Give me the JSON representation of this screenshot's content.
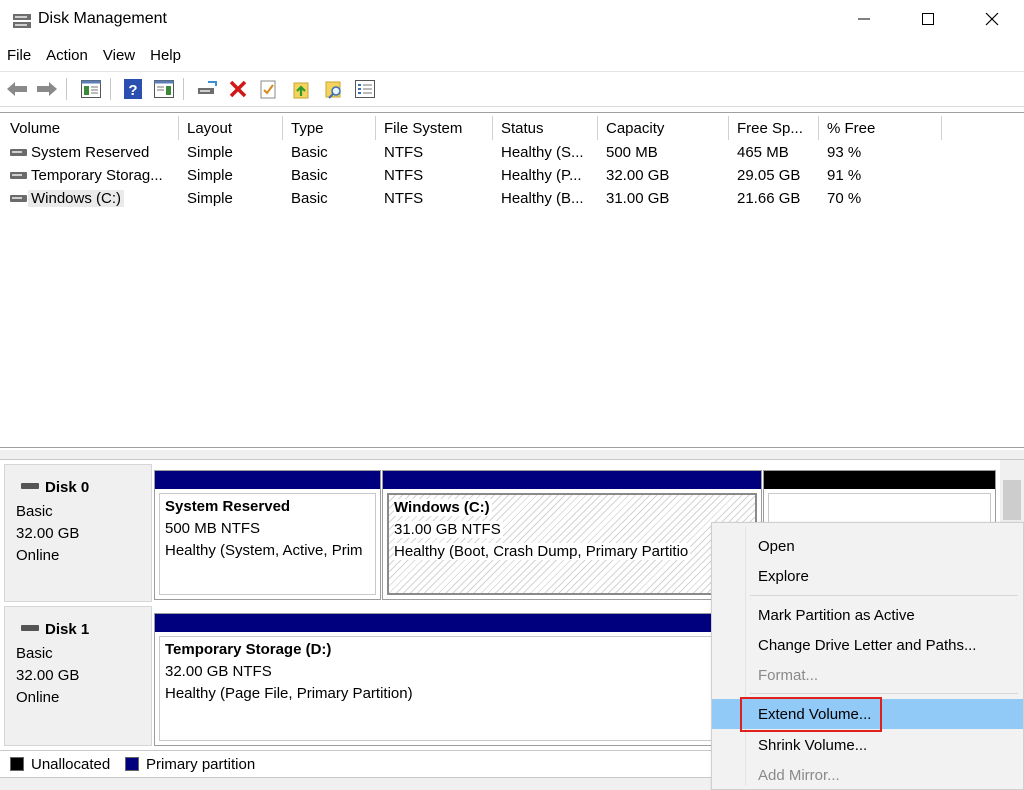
{
  "window": {
    "title": "Disk Management",
    "icon": "disk-management-icon",
    "controls": [
      "minimize-icon",
      "maximize-icon",
      "close-icon"
    ]
  },
  "menu": [
    "File",
    "Action",
    "View",
    "Help"
  ],
  "toolbar": [
    "back-arrow-icon",
    "forward-arrow-icon",
    "console-tree-icon",
    "help-icon",
    "properties-pane-icon",
    "connect-drive-icon",
    "delete-icon",
    "check-icon",
    "folder-up-icon",
    "folder-search-icon",
    "list-view-icon"
  ],
  "volume_table": {
    "columns": [
      "Volume",
      "Layout",
      "Type",
      "File System",
      "Status",
      "Capacity",
      "Free Sp...",
      "% Free"
    ],
    "rows": [
      {
        "volume": "System Reserved",
        "layout": "Simple",
        "type": "Basic",
        "fs": "NTFS",
        "status": "Healthy (S...",
        "capacity": "500 MB",
        "free": "465 MB",
        "pct": "93 %"
      },
      {
        "volume": "Temporary Storag...",
        "layout": "Simple",
        "type": "Basic",
        "fs": "NTFS",
        "status": "Healthy (P...",
        "capacity": "32.00 GB",
        "free": "29.05 GB",
        "pct": "91 %"
      },
      {
        "volume": "Windows (C:)",
        "layout": "Simple",
        "type": "Basic",
        "fs": "NTFS",
        "status": "Healthy (B...",
        "capacity": "31.00 GB",
        "free": "21.66 GB",
        "pct": "70 %"
      }
    ]
  },
  "disks": [
    {
      "name": "Disk 0",
      "type": "Basic",
      "size": "32.00 GB",
      "state": "Online",
      "partitions": [
        {
          "name": "System Reserved",
          "line1": "500 MB NTFS",
          "line2": "Healthy (System, Active, Prim"
        },
        {
          "name": "Windows  (C:)",
          "line1": "31.00 GB NTFS",
          "line2": "Healthy (Boot, Crash Dump, Primary Partitio"
        }
      ]
    },
    {
      "name": "Disk 1",
      "type": "Basic",
      "size": "32.00 GB",
      "state": "Online",
      "partitions": [
        {
          "name": "Temporary Storage  (D:)",
          "line1": "32.00 GB NTFS",
          "line2": "Healthy (Page File, Primary Partition)"
        }
      ]
    }
  ],
  "legend": {
    "unallocated": "Unallocated",
    "primary": "Primary partition",
    "unallocated_color": "#000000",
    "primary_color": "#00007f"
  },
  "context_menu": {
    "items": [
      {
        "label": "Open",
        "enabled": true
      },
      {
        "label": "Explore",
        "enabled": true
      },
      {
        "label": "Mark Partition as Active",
        "enabled": true
      },
      {
        "label": "Change Drive Letter and Paths...",
        "enabled": true
      },
      {
        "label": "Format...",
        "enabled": false
      },
      {
        "label": "Extend Volume...",
        "enabled": true,
        "highlighted": true
      },
      {
        "label": "Shrink Volume...",
        "enabled": true
      },
      {
        "label": "Add Mirror...",
        "enabled": false
      }
    ],
    "highlight_color": "#91c9f7",
    "callout_color": "#e0201c"
  }
}
